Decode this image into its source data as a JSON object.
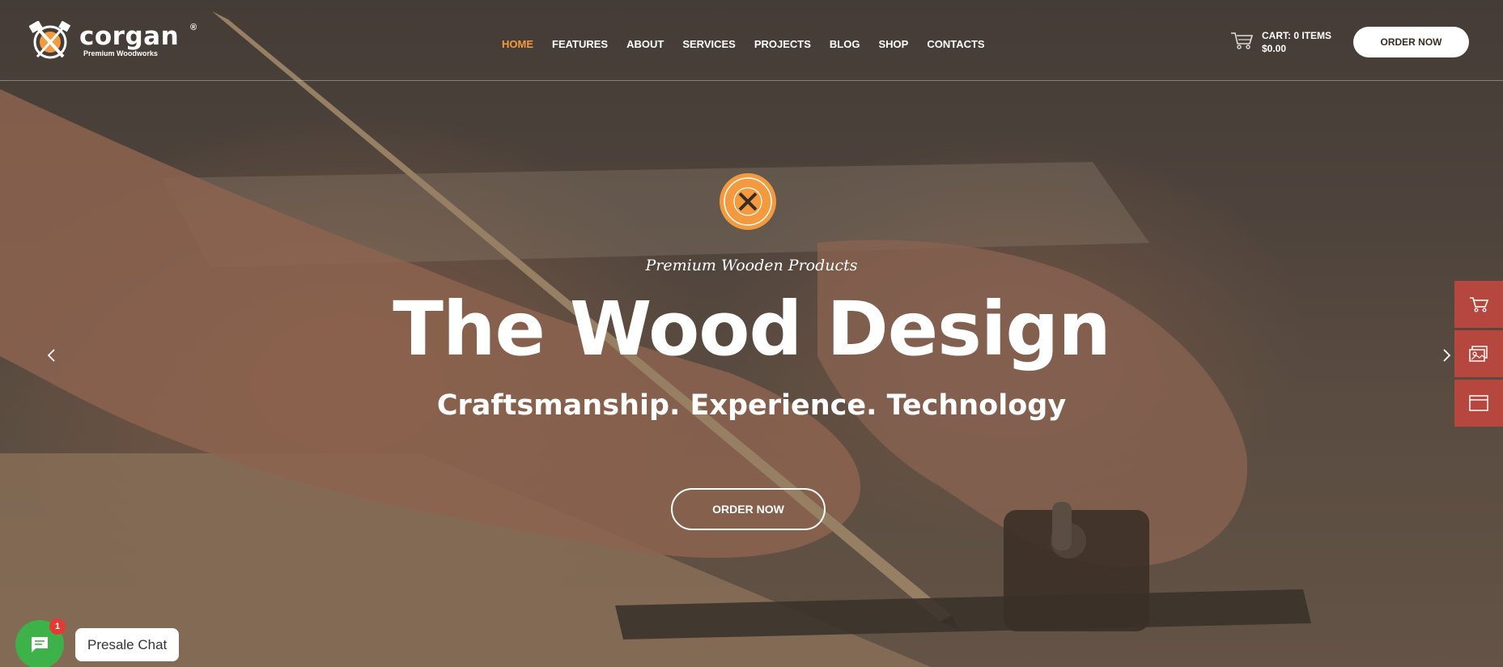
{
  "brand": {
    "name": "corgan",
    "registered": "®",
    "tagline": "Premium Woodworks"
  },
  "nav": {
    "items": [
      {
        "label": "HOME",
        "active": true
      },
      {
        "label": "FEATURES",
        "active": false
      },
      {
        "label": "ABOUT",
        "active": false
      },
      {
        "label": "SERVICES",
        "active": false
      },
      {
        "label": "PROJECTS",
        "active": false
      },
      {
        "label": "BLOG",
        "active": false
      },
      {
        "label": "SHOP",
        "active": false
      },
      {
        "label": "CONTACTS",
        "active": false
      }
    ]
  },
  "cart": {
    "label": "CART: 0 ITEMS",
    "total": "$0.00",
    "icon": "cart-icon"
  },
  "header": {
    "order_label": "ORDER NOW"
  },
  "hero": {
    "badge_icon": "premium-quality-badge-icon",
    "subtitle": "Premium Wooden Products",
    "title": "The Wood Design",
    "tagline": "Craftsmanship. Experience. Technology",
    "cta_label": "ORDER NOW",
    "prev_icon": "chevron-left-icon",
    "next_icon": "chevron-right-icon"
  },
  "side_panel": {
    "icons": [
      "cart-icon",
      "image-gallery-icon",
      "browser-window-icon"
    ]
  },
  "chat": {
    "icon": "chat-icon",
    "unread_count": "1",
    "label": "Presale Chat"
  },
  "colors": {
    "accent": "#f29a3d",
    "side_panel": "#b6473e",
    "chat": "#3db249",
    "badge": "#e53935"
  }
}
